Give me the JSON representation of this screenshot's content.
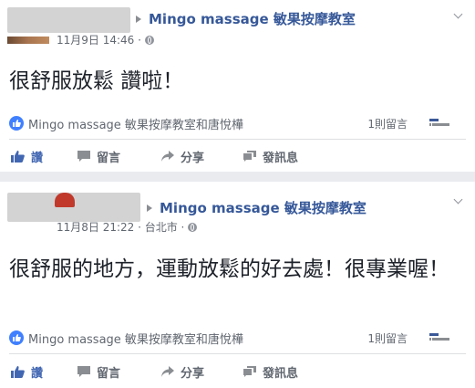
{
  "posts": [
    {
      "page_name": "Mingo massage 敏果按摩教室",
      "timestamp": "11月9日 14:46 ·",
      "text": "很舒服放鬆 讚啦！",
      "reactions_label": "Mingo massage 敏果按摩教室和唐悅樺",
      "comment_count": "1則留言",
      "actions": {
        "like": "讚",
        "comment": "留言",
        "share": "分享",
        "message": "發訊息"
      }
    },
    {
      "page_name": "Mingo massage 敏果按摩教室",
      "timestamp": "11月8日 21:22 · 台北市 ·",
      "text": "很舒服的地方，運動放鬆的好去處！很專業喔！",
      "reactions_label": "Mingo massage 敏果按摩教室和唐悅樺",
      "comment_count": "1則留言",
      "actions": {
        "like": "讚",
        "comment": "留言",
        "share": "分享",
        "message": "發訊息"
      }
    }
  ],
  "colors": {
    "link_blue": "#365899",
    "like_blue": "#4267b2",
    "badge_blue": "#4080ff",
    "text_dark": "#1d2129",
    "text_grey": "#616770",
    "feed_bg": "#e9ebee"
  }
}
